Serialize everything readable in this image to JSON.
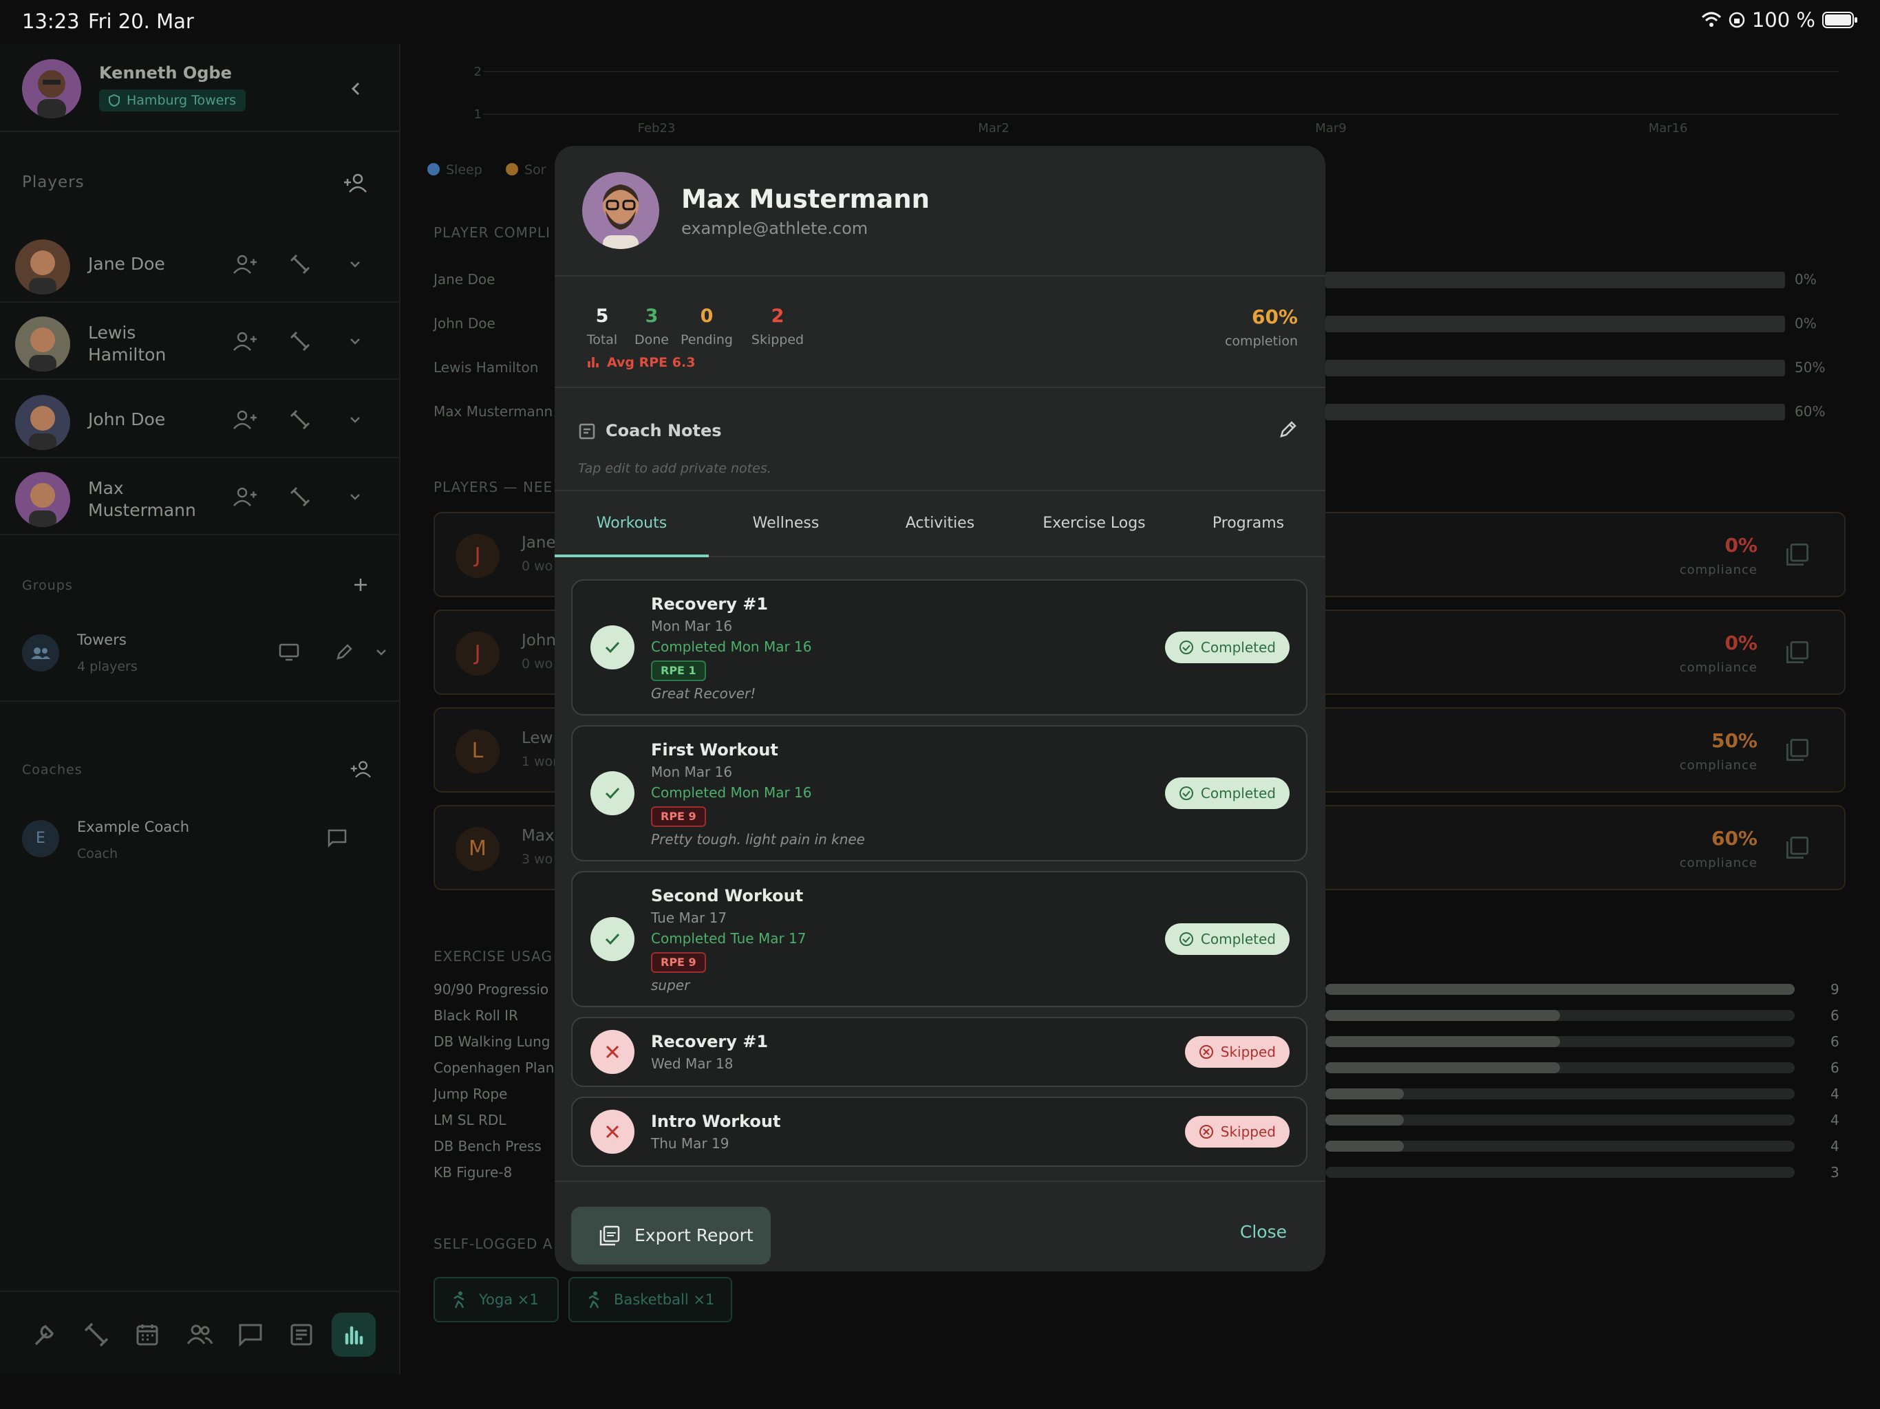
{
  "status_bar": {
    "time": "13:23",
    "date": "Fri 20. Mar",
    "battery": "100 %"
  },
  "coach": {
    "name": "Kenneth Ogbe",
    "team": "Hamburg Towers"
  },
  "sidebar": {
    "players_title": "Players",
    "players": [
      {
        "name": "Jane Doe"
      },
      {
        "name": "Lewis Hamilton"
      },
      {
        "name": "John Doe"
      },
      {
        "name": "Max Mustermann"
      }
    ],
    "groups_title": "Groups",
    "group": {
      "name": "Towers",
      "count": "4 players"
    },
    "coaches_title": "Coaches",
    "coach_item": {
      "initial": "E",
      "name": "Example Coach",
      "role": "Coach"
    }
  },
  "dashboard": {
    "chart_ticks_y": [
      "2",
      "1"
    ],
    "chart_ticks_x": [
      "Feb23",
      "Mar2",
      "Mar9",
      "Mar16"
    ],
    "legend": [
      "Sleep",
      "Sor"
    ],
    "compliance_title": "PLAYER COMPLI",
    "compliance_rows": [
      {
        "name": "Jane Doe",
        "pct": "0%"
      },
      {
        "name": "John Doe",
        "pct": "0%"
      },
      {
        "name": "Lewis Hamilton",
        "pct": "50%"
      },
      {
        "name": "Max Mustermann",
        "pct": "60%"
      }
    ],
    "needs_title": "PLAYERS — NEE",
    "needs_cards": [
      {
        "letter": "J",
        "name": "Jane",
        "sub": "0 wo",
        "pct": "0%",
        "compl": "compliance",
        "color": "#a8372e"
      },
      {
        "letter": "J",
        "name": "John",
        "sub": "0 wo",
        "pct": "0%",
        "compl": "compliance",
        "color": "#a8372e"
      },
      {
        "letter": "L",
        "name": "Lew",
        "sub": "1 wor",
        "pct": "50%",
        "compl": "compliance",
        "color": "#a5652a"
      },
      {
        "letter": "M",
        "name": "Max",
        "sub": "3 wo",
        "pct": "60%",
        "compl": "compliance",
        "color": "#a5652a"
      }
    ],
    "exercise_title": "EXERCISE USAG",
    "exercises": [
      {
        "name": "90/90 Progressio",
        "count": "9",
        "value": 9
      },
      {
        "name": "Black Roll IR",
        "count": "6",
        "value": 6
      },
      {
        "name": "DB Walking Lung",
        "count": "6",
        "value": 6
      },
      {
        "name": "Copenhagen Plan",
        "count": "6",
        "value": 6
      },
      {
        "name": "Jump Rope",
        "count": "4",
        "value": 4
      },
      {
        "name": "LM SL RDL",
        "count": "4",
        "value": 4
      },
      {
        "name": "DB Bench Press",
        "count": "4",
        "value": 4
      },
      {
        "name": "KB Figure-8",
        "count": "3",
        "value": 3
      }
    ],
    "selflogged_title": "SELF-LOGGED A",
    "chips": [
      "Yoga  ×1",
      "Basketball  ×1"
    ]
  },
  "modal": {
    "name": "Max Mustermann",
    "email": "example@athlete.com",
    "stats": {
      "total": {
        "value": "5",
        "label": "Total"
      },
      "done": {
        "value": "3",
        "label": "Done"
      },
      "pending": {
        "value": "0",
        "label": "Pending"
      },
      "skipped": {
        "value": "2",
        "label": "Skipped"
      }
    },
    "avg_rpe": "Avg RPE 6.3",
    "completion": {
      "value": "60%",
      "label": "completion"
    },
    "notes_title": "Coach Notes",
    "notes_hint": "Tap edit to add private notes.",
    "tabs": [
      "Workouts",
      "Wellness",
      "Activities",
      "Exercise Logs",
      "Programs"
    ],
    "workouts": [
      {
        "title": "Recovery #1",
        "date": "Mon Mar 16",
        "completed": "Completed Mon Mar 16",
        "rpe": "RPE 1",
        "note": "Great Recover!",
        "status": "Completed"
      },
      {
        "title": "First Workout",
        "date": "Mon Mar 16",
        "completed": "Completed Mon Mar 16",
        "rpe": "RPE 9",
        "note": "Pretty tough. light pain in knee",
        "status": "Completed"
      },
      {
        "title": "Second Workout",
        "date": "Tue Mar 17",
        "completed": "Completed Tue Mar 17",
        "rpe": "RPE 9",
        "note": "super",
        "status": "Completed"
      },
      {
        "title": "Recovery #1",
        "date": "Wed Mar 18",
        "status": "Skipped"
      },
      {
        "title": "Intro Workout",
        "date": "Thu Mar 19",
        "status": "Skipped"
      }
    ],
    "export_label": "Export Report",
    "close_label": "Close"
  },
  "colors": {
    "accent": "#7fd4bd",
    "done": "#4caf6a",
    "pending": "#e8a23a",
    "skipped": "#e24c3c"
  }
}
